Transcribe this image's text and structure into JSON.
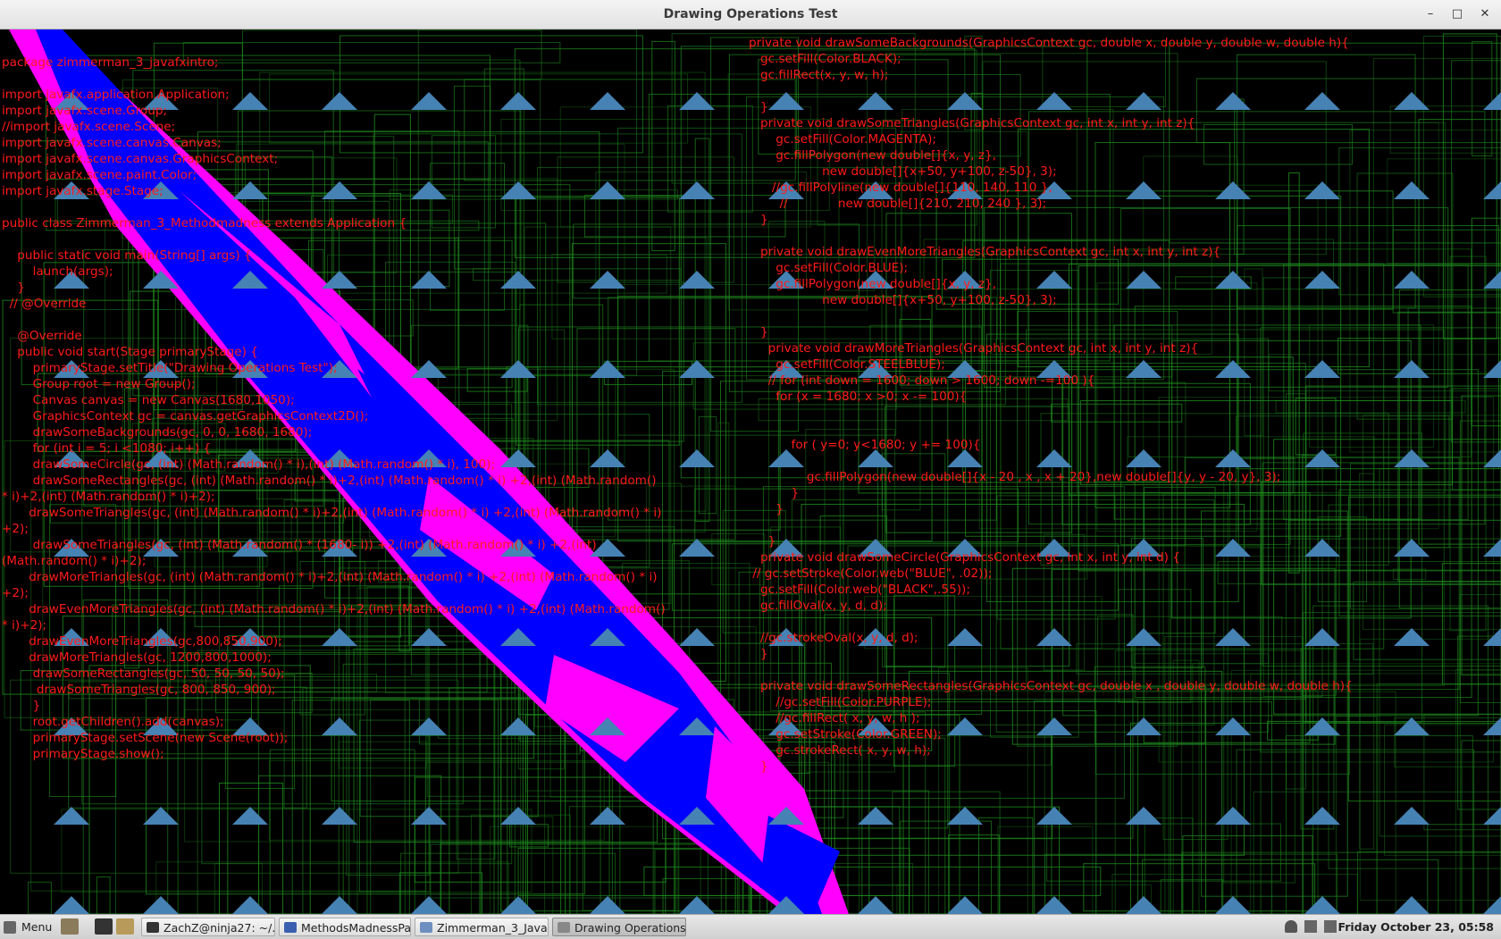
{
  "window": {
    "title": "Drawing Operations Test",
    "minimize_glyph": "–",
    "maximize_glyph": "□",
    "close_glyph": "✕"
  },
  "colors": {
    "background": "#000000",
    "grid_lines": "#1f8a1f",
    "triangles": "#4682b4",
    "code_text": "#ff1a1a",
    "band_magenta": "#ff00ff",
    "band_blue": "#0000ff"
  },
  "code_left": [
    "package zimmerman_3_javafxintro;",
    "",
    "import javafx.application.Application;",
    "import javafx.scene.Group;",
    "//import javafx.scene.Scene;",
    "import javafx.scene.canvas.Canvas;",
    "import javafx.scene.canvas.GraphicsContext;",
    "import javafx.scene.paint.Color;",
    "import javafx.stage.Stage;",
    "",
    "public class Zimmerman_3_Methodmadness extends Application {",
    "",
    "    public static void main(String[] args) {",
    "        launch(args);",
    "    }",
    "  // @Override",
    "",
    "    @Override",
    "    public void start(Stage primaryStage) {",
    "        primaryStage.setTitle(\"Drawing Operations Test\");",
    "        Group root = new Group();",
    "        Canvas canvas = new Canvas(1680,1050);",
    "        GraphicsContext gc = canvas.getGraphicsContext2D();",
    "        drawSomeBackgrounds(gc, 0, 0, 1680, 1680);",
    "        for (int i = 5; i <1080; i++) {",
    "        drawSomeCircle(gc, (int) (Math.random() * i),(int) (Math.random() * i), 100);",
    "        drawSomeRectangles(gc, (int) (Math.random() * i)+2,(int) (Math.random() * i) +2,(int) (Math.random()",
    "* i)+2,(int) (Math.random() * i)+2);",
    "       drawSomeTriangles(gc, (int) (Math.random() * i)+2,(int) (Math.random() * i) +2,(int) (Math.random() * i)",
    "+2);",
    "        drawSomeTriangles(gc, (int) (Math.random() * (1680- i)) +2,(int) (Math.random() * i) +2,(int)",
    "(Math.random() * i)+2);",
    "       drawMoreTriangles(gc, (int) (Math.random() * i)+2,(int) (Math.random() * i) +2,(int) (Math.random() * i)",
    "+2);",
    "       drawEvenMoreTriangles(gc, (int) (Math.random() * i)+2,(int) (Math.random() * i) +2,(int) (Math.random()",
    "* i)+2);",
    "       drawEvenMoreTriangles(gc,800,850,900);",
    "       drawMoreTriangles(gc, 1200,800,1000);",
    "        drawSomeRectangles(gc, 50, 50, 50, 50);",
    "         drawSomeTriangles(gc, 800, 850, 900);",
    "        }",
    "        root.getChildren().add(canvas);",
    "        primaryStage.setScene(new Scene(root));",
    "        primaryStage.show();"
  ],
  "code_right": [
    "private void drawSomeBackgrounds(GraphicsContext gc, double x, double y, double w, double h){",
    "   gc.setFill(Color.BLACK);",
    "   gc.fillRect(x, y, w, h);",
    "",
    "   }",
    "   private void drawSomeTriangles(GraphicsContext gc, int x, int y, int z){",
    "       gc.setFill(Color.MAGENTA);",
    "       gc.fillPolygon(new double[]{x, y, z},",
    "                   new double[]{x+50, y+100, z-50}, 3);",
    "      //gc.fillPolyline(new double[]{110, 140, 110 },",
    "        //             new double[]{210, 210, 240 }, 3);",
    "   }",
    "",
    "   private void drawEvenMoreTriangles(GraphicsContext gc, int x, int y, int z){",
    "       gc.setFill(Color.BLUE);",
    "       gc.fillPolygon(new double[]{x, y, z},",
    "                   new double[]{x+50, y+100, z-50}, 3);",
    "",
    "   }",
    "     private void drawMoreTriangles(GraphicsContext gc, int x, int y, int z){",
    "       gc.setFill(Color.STEELBLUE);",
    "     // for (int down = 1600; down > 1600; down -=100 ){",
    "       for (x = 1680; x >0; x -= 100){",
    "",
    "",
    "           for ( y=0; y<1680; y += 100){",
    "",
    "               gc.fillPolygon(new double[]{x - 20 , x , x + 20},new double[]{y, y - 20, y}, 3);",
    "           }",
    "       }",
    "",
    "     }",
    "   private void drawSomeCircle(GraphicsContext gc, int x, int y, int d) {",
    " // gc.setStroke(Color.web(\"BLUE\", .02));",
    "   gc.setFill(Color.web(\"BLACK\",.55));",
    "   gc.fillOval(x, y, d, d);",
    "",
    "   //gc.strokeOval(x, y, d, d);",
    "   }",
    "",
    "   private void drawSomeRectangles(GraphicsContext gc, double x , double y, double w, double h){",
    "       //gc.setFill(Color.PURPLE);",
    "       //gc.fillRect( x, y, w, h );",
    "       gc.setStroke(Color.GREEN);",
    "       gc.strokeRect( x, y, w, h);",
    "   }"
  ],
  "taskbar": {
    "menu_label": "Menu",
    "tasks": [
      {
        "label": "ZachZ@ninja27: ~/...",
        "active": false
      },
      {
        "label": "MethodsMadnessPa...",
        "active": false
      },
      {
        "label": "Zimmerman_3_Java...",
        "active": false
      },
      {
        "label": "Drawing Operations...",
        "active": true
      }
    ],
    "clock": "Friday October 23, 05:58"
  }
}
